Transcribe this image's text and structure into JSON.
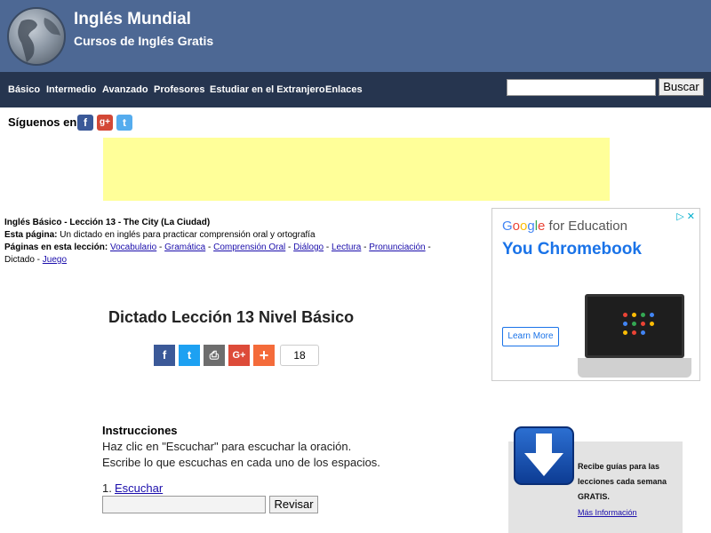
{
  "header": {
    "title": "Inglés Mundial",
    "subtitle": "Cursos de Inglés Gratis",
    "logo_icon": "globe-icon",
    "bg_color": "#4d6894"
  },
  "nav": {
    "items": [
      "Básico",
      "Intermedio",
      "Avanzado",
      "Profesores",
      "Estudiar en el Extranjero",
      "Enlaces"
    ],
    "search_button": "Buscar",
    "bg_color": "#26354f"
  },
  "follow": {
    "label": "Síguenos en",
    "icons": [
      "facebook-icon",
      "google-plus-icon",
      "twitter-icon"
    ],
    "fb_glyph": "f",
    "gp_glyph": "g+",
    "tw_glyph": "t"
  },
  "lesson": {
    "title": "Inglés Básico - Lección 13 - The City (La Ciudad)",
    "page_label": "Esta página:",
    "page_desc": "Un dictado en inglés para practicar comprensión oral y ortografía",
    "pages_label": "Páginas en esta lección:",
    "links": [
      "Vocabulario",
      "Gramática",
      "Comprensión Oral",
      "Diálogo",
      "Lectura",
      "Pronunciación"
    ],
    "sep": " - ",
    "current": "Dictado",
    "last_link": "Juego"
  },
  "dictation": {
    "title": "Dictado Lección 13 Nivel Básico",
    "share_count": "18",
    "share_glyphs": {
      "facebook": "f",
      "twitter": "t",
      "print": "⎙",
      "gplus": "G+",
      "more": "+"
    }
  },
  "ad": {
    "brand_google": [
      "G",
      "o",
      "o",
      "g",
      "l",
      "e"
    ],
    "brand_rest": " for Education",
    "headline": "You Chromebook",
    "cta": "Learn More",
    "choice": "▷ ✕"
  },
  "instructions": {
    "title": "Instrucciones",
    "line1": "Haz clic en \"Escuchar\" para escuchar la oración.",
    "line2": "Escribe lo que escuchas en cada uno de los espacios.",
    "q_number": "1.",
    "listen": "Escuchar",
    "check_button": "Revisar"
  },
  "promo": {
    "line1": "Recibe guías para las",
    "line2": "lecciones cada semana",
    "line3": "GRATIS.",
    "link": "Más Información",
    "icon": "download-arrow-icon"
  }
}
